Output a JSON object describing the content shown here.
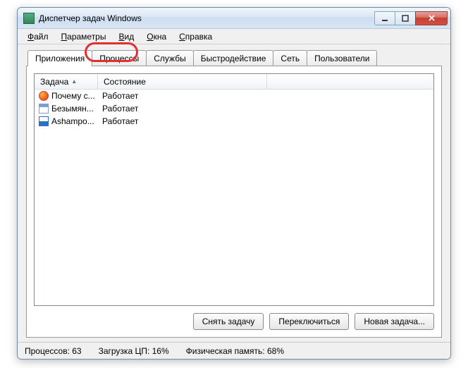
{
  "window": {
    "title": "Диспетчер задач Windows"
  },
  "menus": {
    "file": "Файл",
    "options": "Параметры",
    "view": "Вид",
    "windows": "Окна",
    "help": "Справка"
  },
  "tabs": {
    "applications": "Приложения",
    "processes": "Процессы",
    "services": "Службы",
    "performance": "Быстродействие",
    "network": "Сеть",
    "users": "Пользователи"
  },
  "columns": {
    "task": "Задача",
    "state": "Состояние"
  },
  "tasks": [
    {
      "name": "Почему с...",
      "state": "Работает",
      "icon": "firefox"
    },
    {
      "name": "Безымян...",
      "state": "Работает",
      "icon": "notepad"
    },
    {
      "name": "Ashampo...",
      "state": "Работает",
      "icon": "ashampoo"
    }
  ],
  "buttons": {
    "end_task": "Снять задачу",
    "switch_to": "Переключиться",
    "new_task": "Новая задача..."
  },
  "status": {
    "processes": "Процессов: 63",
    "cpu": "Загрузка ЦП: 16%",
    "memory": "Физическая память: 68%"
  }
}
